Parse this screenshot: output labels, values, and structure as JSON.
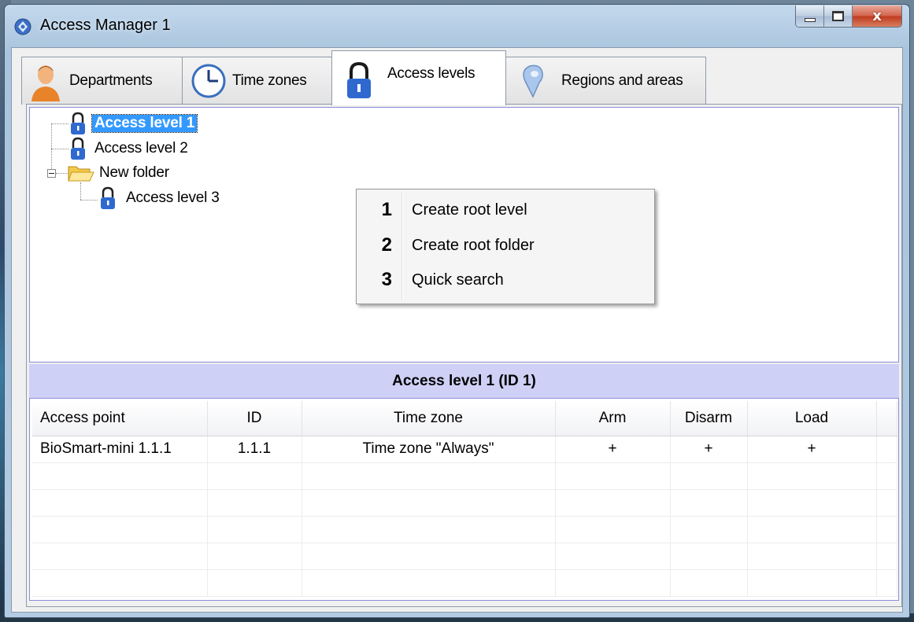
{
  "window": {
    "title": "Access Manager 1",
    "close_glyph": "x"
  },
  "tabs": [
    {
      "label": "Departments",
      "icon": "person-icon",
      "active": false
    },
    {
      "label": "Time zones",
      "icon": "clock-icon",
      "active": false
    },
    {
      "label": "Access levels",
      "icon": "padlock-icon",
      "active": true
    },
    {
      "label": "Regions and areas",
      "icon": "map-pin-icon",
      "active": false
    }
  ],
  "tree": {
    "items": [
      {
        "label": "Access level 1",
        "icon": "padlock-icon",
        "selected": true
      },
      {
        "label": "Access level 2",
        "icon": "padlock-icon"
      },
      {
        "label": "New folder",
        "icon": "folder-open-icon",
        "expanded": true
      },
      {
        "label": "Access level 3",
        "icon": "padlock-icon",
        "parent": "New folder"
      }
    ]
  },
  "context_menu": {
    "items": [
      {
        "number": "1",
        "label": "Create root level"
      },
      {
        "number": "2",
        "label": "Create root folder"
      },
      {
        "number": "3",
        "label": "Quick search"
      }
    ]
  },
  "details": {
    "header": "Access level 1 (ID 1)",
    "columns": [
      "Access point",
      "ID",
      "Time zone",
      "Arm",
      "Disarm",
      "Load"
    ],
    "rows": [
      [
        "BioSmart-mini 1.1.1",
        "1.1.1",
        "Time zone \"Always\"",
        "+",
        "+",
        "+"
      ]
    ]
  },
  "colors": {
    "selection": "#3399ff",
    "detail_header_bg": "#cfd0f6",
    "panel_border": "#8b8ed8"
  }
}
